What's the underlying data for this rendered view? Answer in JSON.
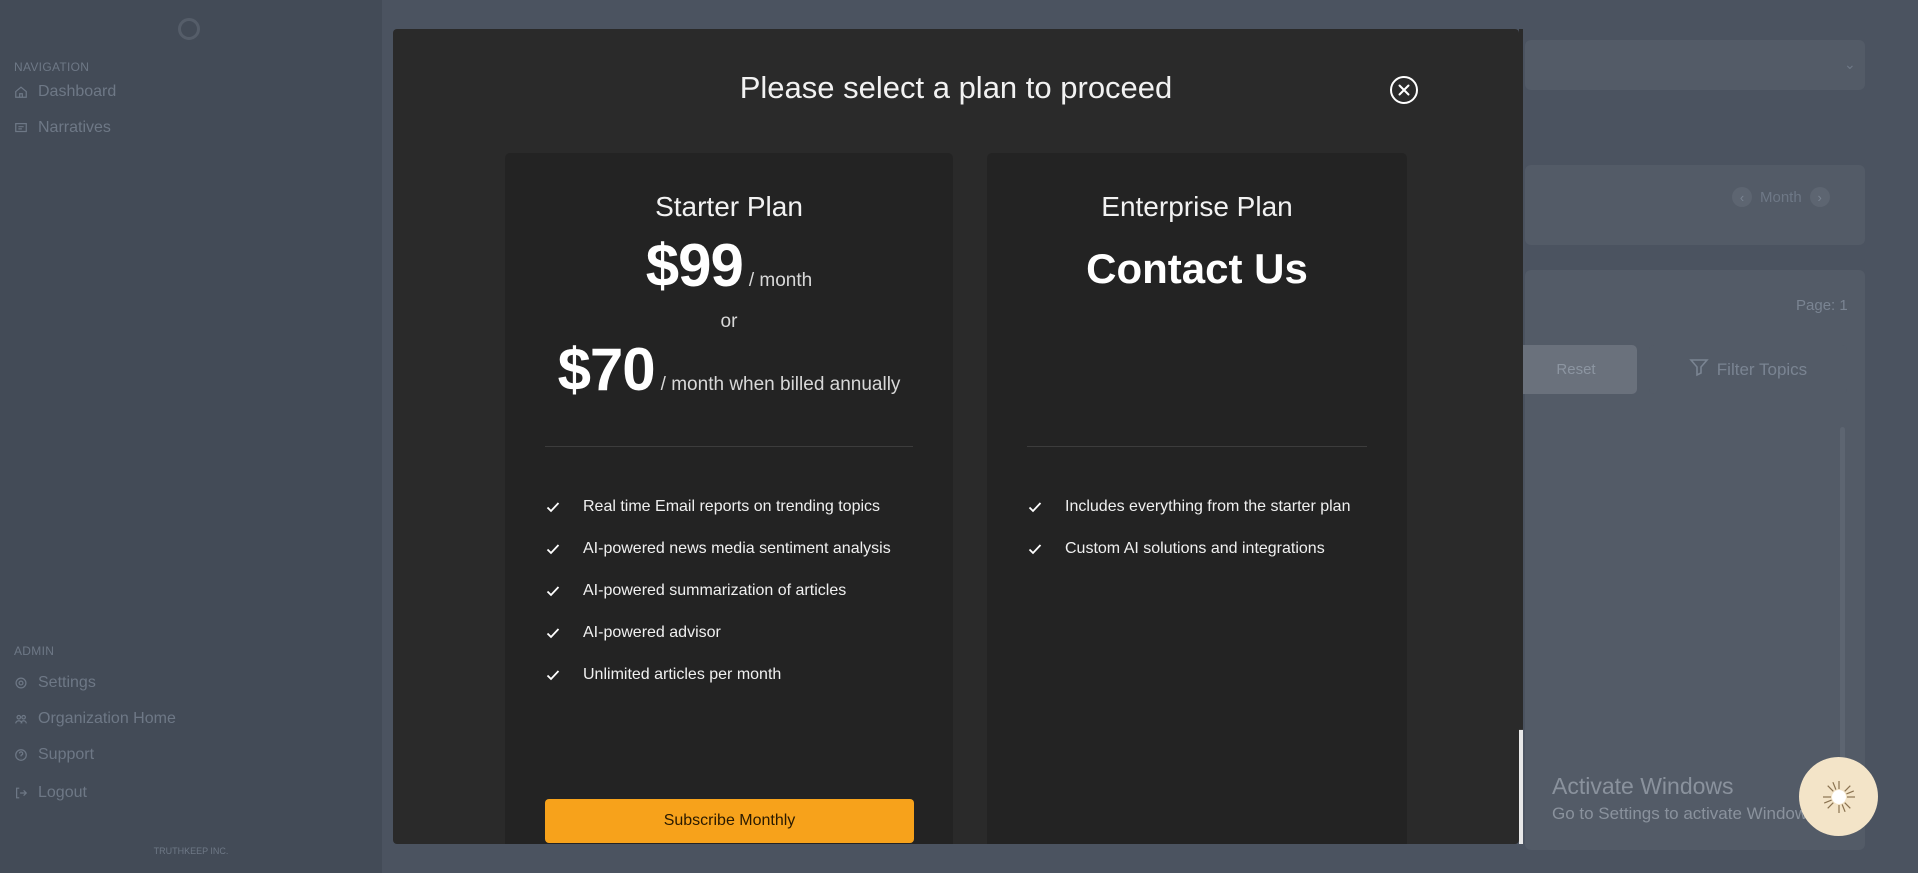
{
  "sidebar": {
    "navigation_heading": "NAVIGATION",
    "nav_items": [
      {
        "label": "Dashboard",
        "icon": "home-icon"
      },
      {
        "label": "Narratives",
        "icon": "message-square-icon"
      }
    ],
    "admin_heading": "ADMIN",
    "admin_items": [
      {
        "label": "Settings",
        "icon": "gear-icon"
      },
      {
        "label": "Organization Home",
        "icon": "users-icon"
      },
      {
        "label": "Support",
        "icon": "help-circle-icon"
      },
      {
        "label": "Logout",
        "icon": "logout-icon"
      }
    ],
    "footer_brand": "TRUTHKEEP INC."
  },
  "background": {
    "month_label": "Month",
    "page_label": "Page: 1",
    "reset_label": "Reset",
    "filter_label": "Filter Topics"
  },
  "windows_watermark": {
    "title": "Activate Windows",
    "subtitle": "Go to Settings to activate Windows."
  },
  "modal": {
    "title": "Please select a plan to proceed",
    "plans": [
      {
        "name": "Starter Plan",
        "price_monthly": "$99",
        "price_monthly_unit": "/ month",
        "or_text": "or",
        "price_annual": "$70",
        "price_annual_unit": "/ month when billed annually",
        "features": [
          "Real time Email reports on trending topics",
          "AI-powered news media sentiment analysis",
          "AI-powered summarization of articles",
          "AI-powered advisor",
          "Unlimited articles per month"
        ],
        "cta_label": "Subscribe Monthly"
      },
      {
        "name": "Enterprise Plan",
        "price_text": "Contact Us",
        "features": [
          "Includes everything from the starter plan",
          "Custom AI solutions and integrations"
        ]
      }
    ]
  },
  "colors": {
    "accent": "#f7a21b",
    "modal_bg": "#2a2a2a",
    "card_bg": "#232323",
    "backdrop": "#4b5360"
  }
}
